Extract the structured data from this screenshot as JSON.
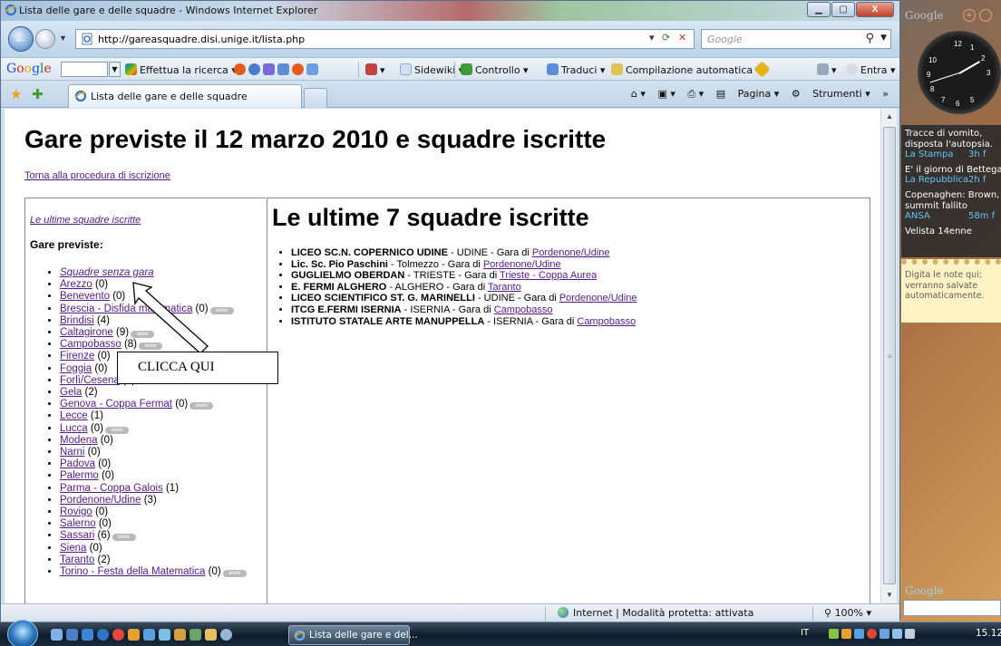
{
  "window": {
    "title": "Lista delle gare e delle squadre - Windows Internet Explorer",
    "buttons": {
      "minimize": "▁",
      "maximize": "▢",
      "close": "X"
    }
  },
  "address_bar": {
    "url": "http://gareasquadre.disi.unige.it/lista.php",
    "search_placeholder": "Google"
  },
  "google_toolbar": {
    "logo": "Google",
    "items": [
      "Effettua la ricerca",
      "Sidewiki",
      "Controllo",
      "Traduci",
      "Compilazione automatica",
      "Entra"
    ]
  },
  "tabs": {
    "active": "Lista delle gare e delle squadre",
    "commands": [
      "Pagina",
      "Strumenti"
    ]
  },
  "page": {
    "heading": "Gare previste il 12 marzo 2010 e squadre iscritte",
    "back_link": "Torna alla procedura di iscrizione",
    "left_frame": {
      "last_teams_link": "Le ultime squadre iscritte",
      "races_label": "Gare previste:",
      "races": [
        {
          "name": "Squadre senza gara",
          "count": "",
          "www": false,
          "italic": true
        },
        {
          "name": "Arezzo",
          "count": " (0)",
          "www": false
        },
        {
          "name": "Benevento",
          "count": " (0)",
          "www": false
        },
        {
          "name": "Brescia - Disfida matematica",
          "count": " (0)",
          "www": true
        },
        {
          "name": "Brindisi",
          "count": " (4)",
          "www": false
        },
        {
          "name": "Caltagirone",
          "count": " (9)",
          "www": true
        },
        {
          "name": "Campobasso",
          "count": " (8)",
          "www": true
        },
        {
          "name": "Firenze",
          "count": " (0)",
          "www": false
        },
        {
          "name": "Foggia",
          "count": " (0)",
          "www": false
        },
        {
          "name": "Forlì/Cesena",
          "count": " (0)",
          "www": false
        },
        {
          "name": "Gela",
          "count": " (2)",
          "www": false
        },
        {
          "name": "Genova - Coppa Fermat",
          "count": " (0)",
          "www": true
        },
        {
          "name": "Lecce",
          "count": " (1)",
          "www": false
        },
        {
          "name": "Lucca",
          "count": " (0)",
          "www": true
        },
        {
          "name": "Modena",
          "count": " (0)",
          "www": false
        },
        {
          "name": "Narni",
          "count": " (0)",
          "www": false
        },
        {
          "name": "Padova",
          "count": " (0)",
          "www": false
        },
        {
          "name": "Palermo",
          "count": " (0)",
          "www": false
        },
        {
          "name": "Parma - Coppa Galois",
          "count": " (1)",
          "www": false
        },
        {
          "name": "Pordenone/Udine",
          "count": " (3)",
          "www": false
        },
        {
          "name": "Rovigo",
          "count": " (0)",
          "www": false
        },
        {
          "name": "Salerno",
          "count": " (0)",
          "www": false
        },
        {
          "name": "Sassari",
          "count": " (6)",
          "www": true
        },
        {
          "name": "Siena",
          "count": " (0)",
          "www": false
        },
        {
          "name": "Taranto",
          "count": " (2)",
          "www": false
        },
        {
          "name": "Torino - Festa della Matematica",
          "count": " (0)",
          "www": true
        }
      ],
      "www_badge": "www"
    },
    "right_frame": {
      "title": "Le ultime 7 squadre iscritte",
      "teams": [
        {
          "school": "LICEO SC.N. COPERNICO UDINE",
          "city": " - UDINE - Gara di ",
          "race": "Pordenone/Udine"
        },
        {
          "school": "Lic. Sc. Pio Paschini",
          "city": " - Tolmezzo - Gara di ",
          "race": "Pordenone/Udine"
        },
        {
          "school": "GUGLIELMO OBERDAN",
          "city": " - TRIESTE - Gara di ",
          "race": "Trieste - Coppa Aurea"
        },
        {
          "school": "E. FERMI ALGHERO",
          "city": " - ALGHERO - Gara di ",
          "race": "Taranto"
        },
        {
          "school": "LICEO SCIENTIFICO ST. G. MARINELLI",
          "city": " - UDINE - Gara di ",
          "race": "Pordenone/Udine"
        },
        {
          "school": "ITCG E.FERMI ISERNIA",
          "city": " - ISERNIA - Gara di ",
          "race": "Campobasso"
        },
        {
          "school": "ISTITUTO STATALE ARTE MANUPPELLA",
          "city": " - ISERNIA - Gara di ",
          "race": "Campobasso"
        }
      ]
    },
    "callout": "CLICCA QUI"
  },
  "status_bar": {
    "zone": "Internet | Modalità protetta: attivata",
    "zoom": "100%"
  },
  "taskbar": {
    "task_button": "Lista delle gare e del...",
    "language": "IT",
    "clock": "15.12"
  },
  "sidebar": {
    "header_logo": "Google",
    "feeds": [
      {
        "headline": "Tracce di vomito,",
        "headline2": "disposta l'autopsia.",
        "source": "La Stampa",
        "age": "3h f"
      },
      {
        "headline": "E' il giorno di Bettega",
        "headline2": "",
        "source": "La Repubblica",
        "age": "2h f"
      },
      {
        "headline": "Copenaghen: Brown,",
        "headline2": "summit fallito",
        "source": "ANSA",
        "age": "58m f"
      },
      {
        "headline": "Velista 14enne",
        "headline2": "",
        "source": "",
        "age": ""
      }
    ],
    "notes_text": "Digita le note qui; verranno salvate automaticamente.",
    "search_label": "Google"
  },
  "colors": {
    "visited_link": "#551a8b",
    "feed_source": "#61c6f5",
    "notes_bg": "#fff3c4"
  }
}
